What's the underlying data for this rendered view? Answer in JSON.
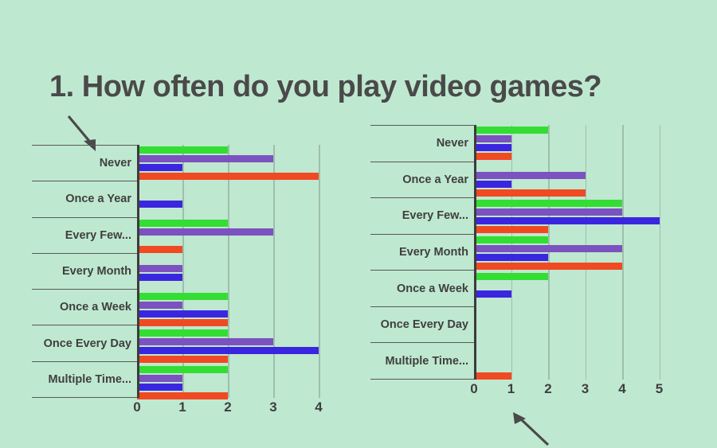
{
  "page": {
    "background_color": "#bfe8d0",
    "title": "1. How often do you play video games?"
  },
  "annotations": {
    "arrow_left": "arrow-down-right",
    "arrow_right": "arrow-up-right"
  },
  "colors": {
    "series_green": "#33dd33",
    "series_purple": "#7b52bf",
    "series_blue": "#3b26e0",
    "series_red": "#f04a23",
    "text": "#3f3f3f",
    "axis": "#3c3c3c",
    "grid": "#9dbfab"
  },
  "chart_data": [
    {
      "id": "left",
      "type": "bar",
      "orientation": "horizontal",
      "title": "",
      "xlabel": "",
      "ylabel": "",
      "xlim": [
        0,
        4.5
      ],
      "xticks": [
        0,
        1,
        2,
        3,
        4
      ],
      "grid": true,
      "legend": "none",
      "categories": [
        "Never",
        "Once a Year",
        "Every Few...",
        "Every Month",
        "Once a Week",
        "Once Every Day",
        "Multiple Time..."
      ],
      "series": [
        {
          "name": "green",
          "color": "#33dd33",
          "values": [
            2,
            0,
            2,
            0,
            2,
            2,
            2
          ]
        },
        {
          "name": "purple",
          "color": "#7b52bf",
          "values": [
            3,
            0,
            3,
            1,
            1,
            3,
            1
          ]
        },
        {
          "name": "blue",
          "color": "#3b26e0",
          "values": [
            1,
            1,
            0,
            1,
            2,
            4,
            1
          ]
        },
        {
          "name": "red",
          "color": "#f04a23",
          "values": [
            4,
            0,
            1,
            0,
            2,
            2,
            2
          ]
        }
      ]
    },
    {
      "id": "right",
      "type": "bar",
      "orientation": "horizontal",
      "title": "",
      "xlabel": "",
      "ylabel": "",
      "xlim": [
        0,
        5.5
      ],
      "xticks": [
        0,
        1,
        2,
        3,
        4,
        5
      ],
      "grid": true,
      "legend": "none",
      "categories": [
        "Never",
        "Once a Year",
        "Every Few...",
        "Every Month",
        "Once a Week",
        "Once Every Day",
        "Multiple Time..."
      ],
      "series": [
        {
          "name": "green",
          "color": "#33dd33",
          "values": [
            2,
            0,
            4,
            2,
            2,
            0,
            0
          ]
        },
        {
          "name": "purple",
          "color": "#7b52bf",
          "values": [
            1,
            3,
            4,
            4,
            0,
            0,
            0
          ]
        },
        {
          "name": "blue",
          "color": "#3b26e0",
          "values": [
            1,
            1,
            5,
            2,
            1,
            0,
            0
          ]
        },
        {
          "name": "red",
          "color": "#f04a23",
          "values": [
            1,
            3,
            2,
            4,
            0,
            0,
            1
          ]
        }
      ]
    }
  ]
}
